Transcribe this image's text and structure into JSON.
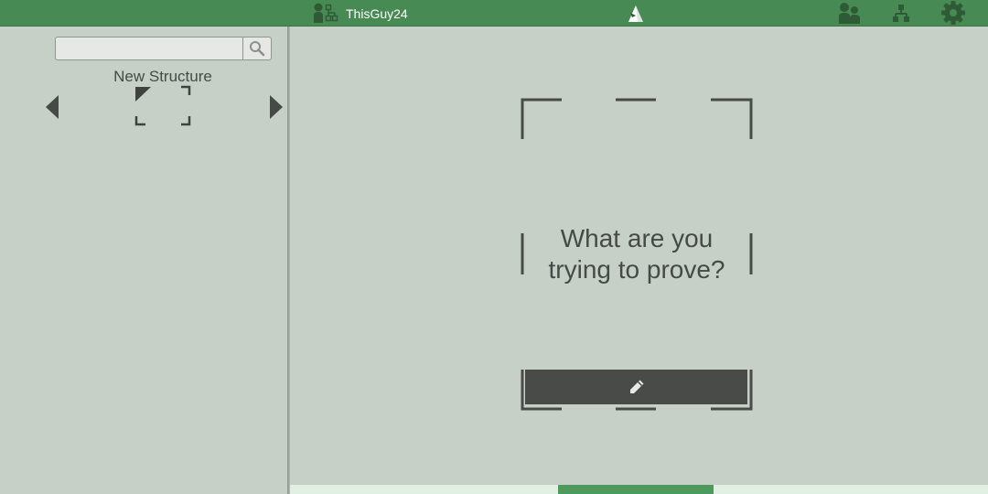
{
  "topbar": {
    "username": "ThisGuy24",
    "icons": [
      "user-structure-icon",
      "logo-icon",
      "people-icon",
      "tree-icon",
      "gear-icon"
    ],
    "background": "#478a53"
  },
  "sidebar": {
    "search": {
      "value": "",
      "placeholder": ""
    },
    "structure_title": "New Structure"
  },
  "main": {
    "prompt": "What are you trying to prove?"
  },
  "colors": {
    "background": "#c6d0c7",
    "dark": "#484b47",
    "accent": "#4e9a5c"
  }
}
